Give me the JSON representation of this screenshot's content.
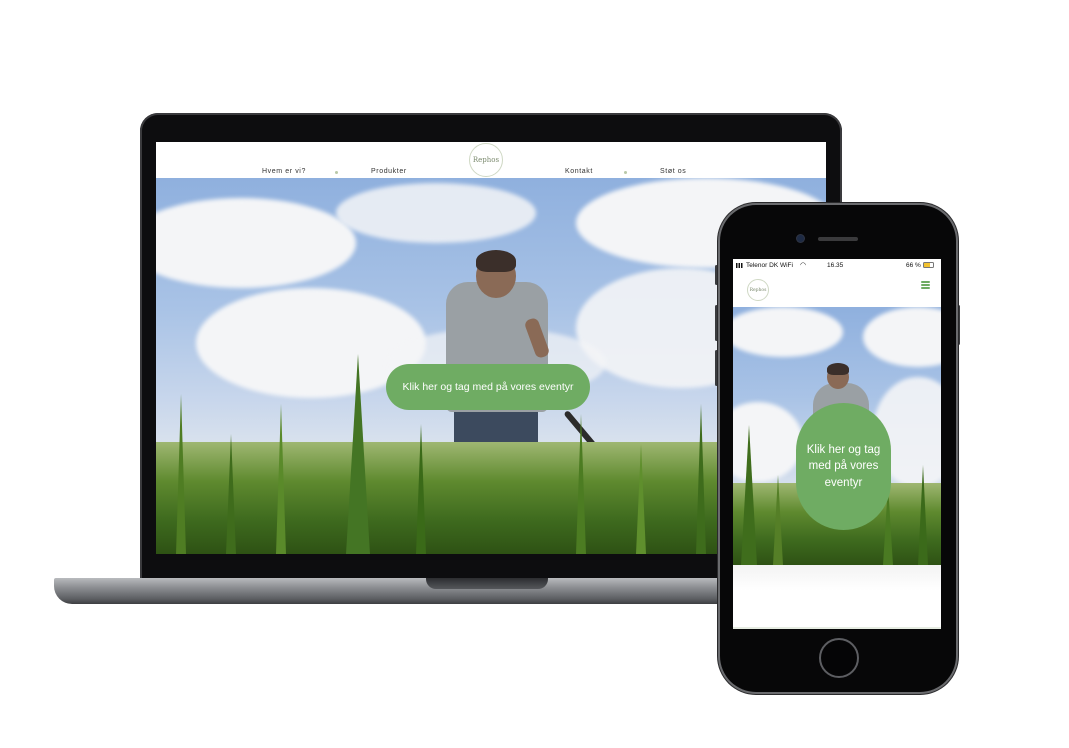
{
  "desktop": {
    "nav": {
      "items": [
        "Hvem er vi?",
        "Produkter",
        "Kontakt",
        "Støt os"
      ],
      "logo_text": "Rephos"
    },
    "hero": {
      "cta_label": "Klik her og tag med på vores eventyr"
    }
  },
  "mobile": {
    "status_bar": {
      "carrier": "Telenor DK WiFi",
      "time": "16.35",
      "battery": "66 %"
    },
    "nav": {
      "logo_text": "Rephos"
    },
    "hero": {
      "cta_label": "Klik her og tag med på vores eventyr"
    }
  },
  "colors": {
    "accent": "#6fac63",
    "device_frame": "#0d0d0f"
  }
}
